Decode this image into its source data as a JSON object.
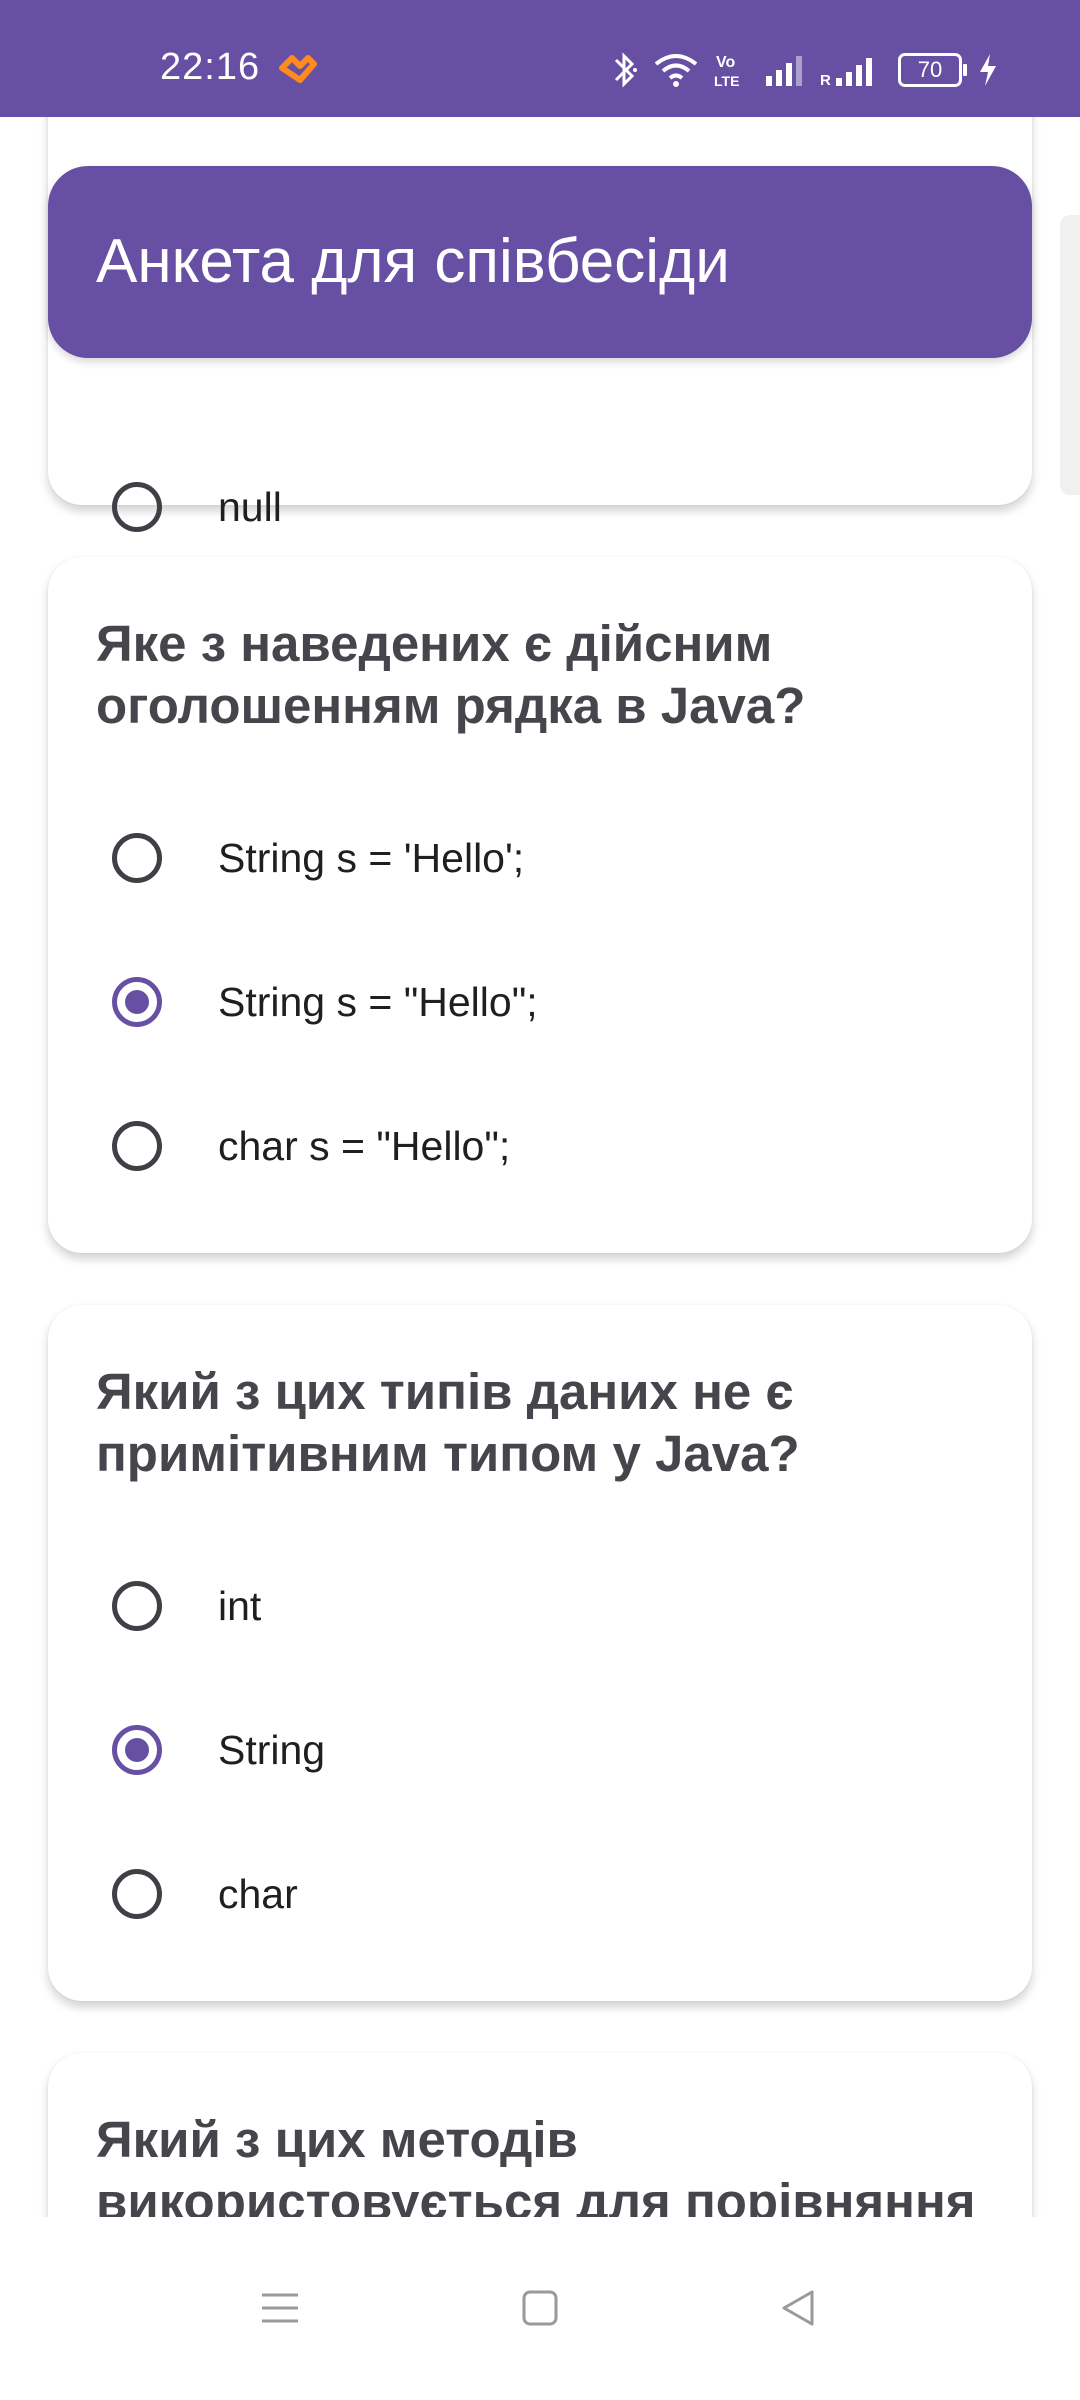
{
  "status_bar": {
    "time": "22:16",
    "battery": "70",
    "background_color": "#6750a4",
    "icons": [
      "app-notification-icon",
      "bluetooth-icon",
      "wifi-icon",
      "volte-icon",
      "signal-icon",
      "signal-roaming-icon",
      "battery-icon",
      "charging-icon"
    ]
  },
  "app_bar": {
    "title": "Анкета для співбесіди"
  },
  "cards": [
    {
      "options": [
        {
          "label": "null",
          "selected": false
        }
      ]
    },
    {
      "question": "Яке з наведених є дійсним оголошенням рядка в Java?",
      "options": [
        {
          "label": "String s = 'Hello';",
          "selected": false
        },
        {
          "label": "String s = \"Hello\";",
          "selected": true
        },
        {
          "label": "char s = \"Hello\";",
          "selected": false
        }
      ]
    },
    {
      "question": "Який з цих типів даних не є примітивним типом у Java?",
      "options": [
        {
          "label": "int",
          "selected": false
        },
        {
          "label": "String",
          "selected": true
        },
        {
          "label": "char",
          "selected": false
        }
      ]
    },
    {
      "question": "Який з цих методів використовується для порівняння"
    }
  ],
  "nav_bar": {
    "icons": [
      "menu-icon",
      "home-icon",
      "back-icon"
    ]
  },
  "colors": {
    "accent": "#6750a4",
    "question_text": "#46454b",
    "option_text": "#1f1f1f"
  }
}
